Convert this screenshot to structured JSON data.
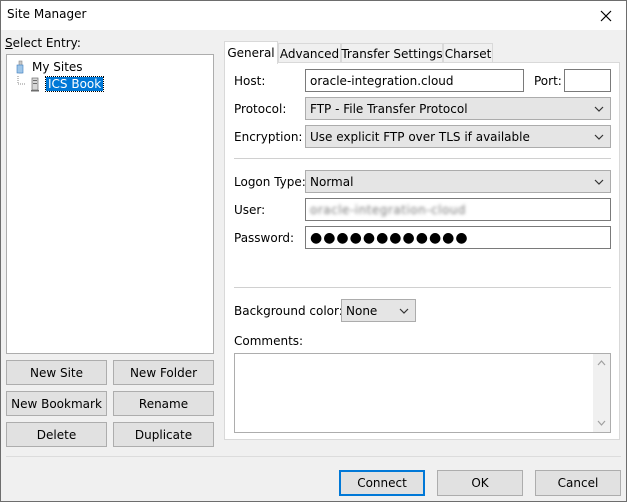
{
  "window": {
    "title": "Site Manager"
  },
  "left": {
    "select_entry_label": "Select Entry:",
    "tree": [
      {
        "label": "My Sites",
        "icon": "folder-icon"
      },
      {
        "label": "ICS Book",
        "icon": "server-icon",
        "selected": true
      }
    ],
    "buttons": {
      "new_site": "New Site",
      "new_folder": "New Folder",
      "new_bookmark": "New Bookmark",
      "rename": "Rename",
      "delete": "Delete",
      "duplicate": "Duplicate"
    }
  },
  "tabs": [
    "General",
    "Advanced",
    "Transfer Settings",
    "Charset"
  ],
  "general": {
    "host_label": "Host:",
    "host_value": "oracle-integration.cloud",
    "port_label": "Port:",
    "port_value": "",
    "protocol_label": "Protocol:",
    "protocol_value": "FTP - File Transfer Protocol",
    "encryption_label": "Encryption:",
    "encryption_value": "Use explicit FTP over TLS if available",
    "logon_type_label": "Logon Type:",
    "logon_type_value": "Normal",
    "user_label": "User:",
    "user_value": "oracle-integration-cloud",
    "password_label": "Password:",
    "password_value": "●●●●●●●●●●●●",
    "background_color_label": "Background color:",
    "background_color_value": "None",
    "comments_label": "Comments:",
    "comments_value": ""
  },
  "footer": {
    "connect": "Connect",
    "ok": "OK",
    "cancel": "Cancel"
  },
  "colors": {
    "accent": "#0078d7",
    "dialog_bg": "#f0f0f0",
    "button_bg": "#e1e1e1"
  }
}
